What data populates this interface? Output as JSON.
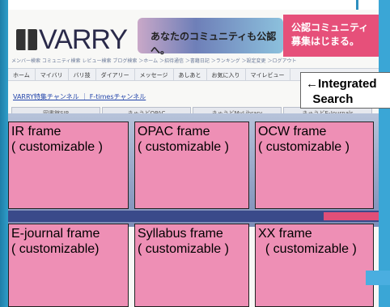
{
  "site": {
    "logo_text": "VARRY",
    "banner_text": "あなたのコミュニティも公認へ。",
    "banner2_text": "公認コミュニティ\n募集はじまる。",
    "link_row": "メンバー検索 コミュニティ検索 レビュー検索 ブログ検索 ＞ホーム ＞招待通信 ＞書籍日記 ＞ランキング ＞設定変更 ＞ログアウト",
    "nav": [
      "ホーム",
      "マイバリ",
      "バリ技",
      "ダイアリー",
      "メッセージ",
      "あしあと",
      "お気に入り",
      "マイレビュー"
    ],
    "channel_link": "VARRY特集チャンネル ｜ F-timesチャンネル",
    "buttons": [
      "図書館SIP",
      "きゅうどOPAC",
      "きゅうどMyLibrary",
      "きゅうどE-Journals"
    ]
  },
  "search_label": "←Integrated\n  Search",
  "frames": [
    {
      "title": "IR frame\n( customizable )"
    },
    {
      "title": "OPAC frame\n( customizable )"
    },
    {
      "title": "OCW frame\n( customizable )"
    },
    {
      "title": "E-journal frame\n( customizable)"
    },
    {
      "title": "Syllabus frame\n( customizable )"
    },
    {
      "title": "XX frame\n  ( customizable )"
    }
  ],
  "colors": {
    "frame_fill": "#ee8fb5",
    "accent_blue": "#2f9cc8",
    "banner_pink": "#e6507a"
  }
}
